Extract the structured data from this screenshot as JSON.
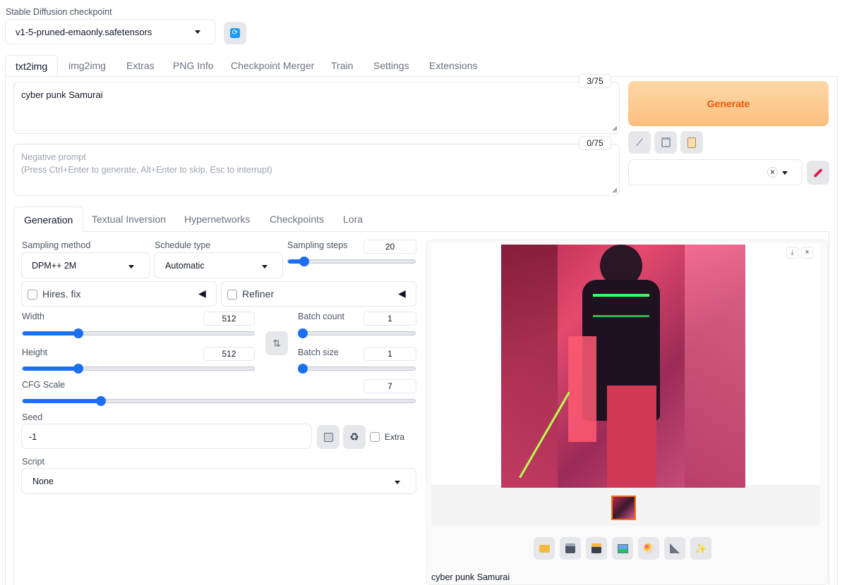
{
  "checkpoint": {
    "label": "Stable Diffusion checkpoint",
    "value": "v1-5-pruned-emaonly.safetensors",
    "refresh_icon": "refresh-icon"
  },
  "main_tabs": [
    "txt2img",
    "img2img",
    "Extras",
    "PNG Info",
    "Checkpoint Merger",
    "Train",
    "Settings",
    "Extensions"
  ],
  "prompt": {
    "value": "cyber punk Samurai",
    "token_count": "3/75"
  },
  "negative_prompt": {
    "placeholder_line1": "Negative prompt",
    "placeholder_line2": "(Press Ctrl+Enter to generate, Alt+Enter to skip, Esc to interrupt)",
    "token_count": "0/75"
  },
  "generate": {
    "label": "Generate",
    "color": "#fbbf7e"
  },
  "tool_icons": [
    "pencil-icon",
    "trash-icon",
    "clipboard-icon",
    "paint-brush-icon"
  ],
  "styles_dropdown": {
    "clear_symbol": "×"
  },
  "sub_tabs": [
    "Generation",
    "Textual Inversion",
    "Hypernetworks",
    "Checkpoints",
    "Lora"
  ],
  "generation": {
    "sampling_method": {
      "label": "Sampling method",
      "value": "DPM++ 2M"
    },
    "schedule_type": {
      "label": "Schedule type",
      "value": "Automatic"
    },
    "sampling_steps": {
      "label": "Sampling steps",
      "value": "20",
      "fraction": 0.13
    },
    "hires_fix": {
      "label": "Hires. fix"
    },
    "refiner": {
      "label": "Refiner"
    },
    "width": {
      "label": "Width",
      "value": "512",
      "fraction": 0.24
    },
    "height": {
      "label": "Height",
      "value": "512",
      "fraction": 0.24
    },
    "batch_count": {
      "label": "Batch count",
      "value": "1",
      "fraction": 0.0
    },
    "batch_size": {
      "label": "Batch size",
      "value": "1",
      "fraction": 0.0
    },
    "swap_symbol": "⇅",
    "cfg_scale": {
      "label": "CFG Scale",
      "value": "7",
      "fraction": 0.2
    },
    "seed": {
      "label": "Seed",
      "value": "-1",
      "extra_label": "Extra"
    },
    "script": {
      "label": "Script",
      "value": "None"
    }
  },
  "output": {
    "caption": "cyber punk Samurai",
    "toolbar_icons": [
      "folder-icon",
      "save-icon",
      "zip-icon",
      "image-icon",
      "palette-icon",
      "ruler-icon",
      "sparkles-icon"
    ],
    "accent_color": "#f97316"
  }
}
